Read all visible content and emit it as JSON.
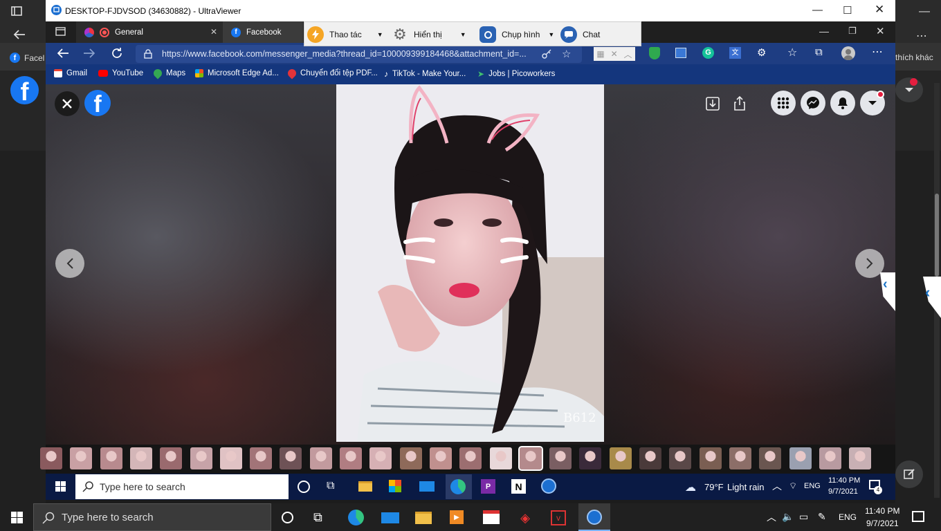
{
  "host": {
    "left_tab_fragment": "Facel",
    "right_tab_fragment": "thích khác"
  },
  "ultraviewer": {
    "title": "DESKTOP-FJDVSOD (34630882) - UltraViewer",
    "toolbar": {
      "actions_label": "Thao tác",
      "display_label": "Hiển thị",
      "screenshot_label": "Chụp hình",
      "chat_label": "Chat"
    }
  },
  "edge": {
    "tabs": [
      {
        "label": "General",
        "active": false
      },
      {
        "label": "Facebook",
        "active": true
      }
    ],
    "url": "https://www.facebook.com/messenger_media?thread_id=100009399184468&attachment_id=...",
    "bookmarks": [
      "Gmail",
      "YouTube",
      "Maps",
      "Microsoft Edge Ad...",
      "Chuyển đổi tệp PDF...",
      "TikTok - Make Your...",
      "Jobs | Picoworkers"
    ]
  },
  "viewer": {
    "photo_watermark": "B612",
    "thumbnail_count": 28
  },
  "inner_taskbar": {
    "search_placeholder": "Type here to search",
    "weather_temp": "79°F",
    "weather_desc": "Light rain",
    "lang": "ENG",
    "time": "11:40 PM",
    "date": "9/7/2021",
    "notification_count": "4"
  },
  "outer_taskbar": {
    "search_placeholder": "Type here to search",
    "lang": "ENG",
    "time": "11:40 PM",
    "date": "9/7/2021"
  },
  "colors": {
    "facebook_blue": "#1877f2",
    "edge_address_blue": "#1e3d82",
    "taskbar_dark": "#202020"
  }
}
